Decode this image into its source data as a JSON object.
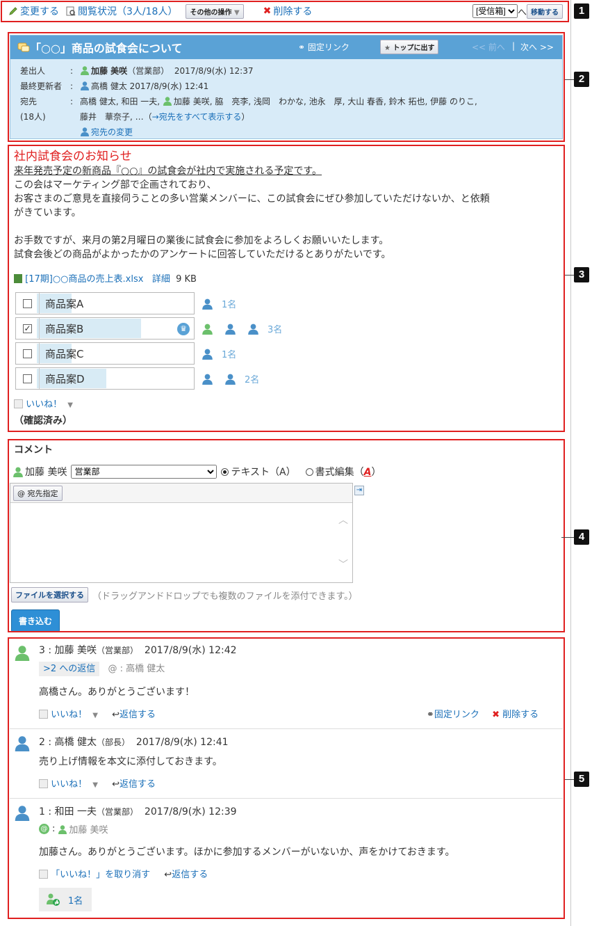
{
  "markers": [
    "1",
    "2",
    "3",
    "4",
    "5"
  ],
  "toolbar": {
    "change": "変更する",
    "read_status": "閲覧状況（3人/18人）",
    "other_ops": "その他の操作",
    "delete": "削除する",
    "folder_select": "[受信箱]",
    "to": "へ",
    "move_button": "移動する"
  },
  "message": {
    "title": "「○○」商品の試食会について",
    "permalink": "固定リンク",
    "to_top": "トップに出す",
    "prev": "<< 前へ",
    "separator": "|",
    "next": "次へ >>",
    "sender_label": "差出人",
    "sender_name": "加藤 美咲",
    "sender_dept": "（営業部）",
    "sender_time": "2017/8/9(水) 12:37",
    "updater_label": "最終更新者",
    "updater": "高橋 健太 2017/8/9(水) 12:41",
    "to_label": "宛先",
    "to_count": "(18人)",
    "recipients_line1_a": "高橋 健太, 和田 一夫,",
    "recipients_line1_b": "加藤 美咲, 脇　亮李, 浅岡　わかな, 池永　厚, 大山 春香, 鈴木 拓也, 伊藤 のりこ,",
    "recipients_line2": "藤井　華奈子, …（",
    "show_all": "→宛先をすべて表示する",
    "recipients_close": "）",
    "change_recipients": "宛先の変更"
  },
  "body": {
    "heading": "社内試食会のお知らせ",
    "lines": [
      "来年発売予定の新商品『○○』の試食会が社内で実施される予定です。",
      "この会はマーケティング部で企画されており、",
      "お客さまのご意見を直接伺うことの多い営業メンバーに、この試食会にぜひ参加していただけないか、と依頼",
      "がきています。",
      "",
      "お手数ですが、来月の第2月曜日の業後に試食会に参加をよろしくお願いいたします。",
      "試食会後どの商品がよかったかのアンケートに回答していただけるとありがたいです。"
    ],
    "attachment": "[17期]○○商品の売上表.xlsx",
    "attachment_detail": "詳細",
    "attachment_size": "9 KB",
    "poll": [
      {
        "label": "商品案A",
        "checked": false,
        "votes": "1名",
        "share": 0.25
      },
      {
        "label": "商品案B",
        "checked": true,
        "votes": "3名",
        "share": 0.75
      },
      {
        "label": "商品案C",
        "checked": false,
        "votes": "1名",
        "share": 0.25
      },
      {
        "label": "商品案D",
        "checked": false,
        "votes": "2名",
        "share": 0.5
      }
    ],
    "like": "いいね！",
    "confirmed": "（確認済み）"
  },
  "comment_form": {
    "title": "コメント",
    "user": "加藤 美咲",
    "dept_select": "営業部",
    "mode_text": "テキスト（A）",
    "mode_format": "書式編集（",
    "mode_format_key": "A",
    "mode_format_close": "）",
    "mention_button": "@ 宛先指定",
    "file_button": "ファイルを選択する",
    "file_hint": "（ドラッグアンドドロップでも複数のファイルを添付できます。）",
    "submit": "書き込む"
  },
  "comments": [
    {
      "header": "3 : 加藤 美咲",
      "dept": "（営業部）",
      "time": "2017/8/9(水) 12:42",
      "reply_to": ">2 への返信",
      "mention": "@ : 高橋 健太",
      "text": "高橋さん。ありがとうございます！",
      "like": "いいね！",
      "reply": "返信する",
      "permalink": "固定リンク",
      "delete": "削除する"
    },
    {
      "header": "2 : 高橋 健太",
      "dept": "（部長）",
      "time": "2017/8/9(水) 12:41",
      "text": "売り上げ情報を本文に添付しておきます。",
      "like": "いいね！",
      "reply": "返信する"
    },
    {
      "header": "1 : 和田 一夫",
      "dept": "（営業部）",
      "time": "2017/8/9(水) 12:39",
      "mention_prefix": ":",
      "mention_name": "加藤 美咲",
      "text": "加藤さん。ありがとうございます。ほかに参加するメンバーがいないか、声をかけておきます。",
      "unlike": "「いいね！」を取り消す",
      "reply": "返信する",
      "like_count": "1名"
    }
  ],
  "colors": {
    "title_bar": "#5aa2d6",
    "header_bg": "#d8ebf8",
    "link": "#1a6fb8",
    "annotation_red": "#e02020",
    "user_icon_blue": "#4a90c8",
    "user_icon_green": "#6cc06c"
  }
}
